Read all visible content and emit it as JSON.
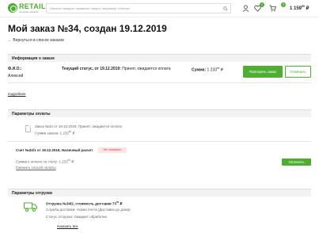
{
  "header": {
    "logo_text": "RETAIL",
    "logo_sub": "интернет-магазин",
    "search_placeholder": "Начните вводить название товара, например «Свечи»",
    "compare_count": "1",
    "cart_count": "3",
    "cart_price_main": "1 159",
    "cart_price_cents": "50",
    "cart_currency": "₽"
  },
  "page": {
    "title": "Мой заказ №34, создан 19.12.2019",
    "back_link": "← Вернуться в список заказов"
  },
  "order_info": {
    "heading": "Информация о заказе",
    "fio_label": "Ф.И.О.:",
    "fio_value": "Алексей",
    "status_label": "Текущий статус, от 19.12.2019:",
    "status_value": "Принят, ожидается оплата",
    "sum_label": "Сумма:",
    "sum_value": "1 233",
    "sum_cents": "50",
    "sum_currency": "₽",
    "repeat_button": "Повторить заказ",
    "cancel_button": "Отменить",
    "details_link": "подробнее"
  },
  "payment": {
    "heading": "Параметры оплаты",
    "line1": "Заказ №34 от 19.12.2019, Принят, ожидается оплата",
    "line2_label": "Сумма заказа:",
    "line2_value": "1 233",
    "line2_cents": "50",
    "line2_currency": "₽",
    "invoice_title": "Счет №34/1 от 19.12.2019, Наличный расчет",
    "invoice_status": "Не оплачено",
    "pay_sum_label": "Сумма к оплате по счету:",
    "pay_sum_value": "1 233",
    "pay_sum_cents": "50",
    "pay_sum_currency": "₽",
    "change_link": "Сменить способ оплаты",
    "pay_button": "Оплатить"
  },
  "shipment": {
    "heading": "Параметры отгрузки",
    "title": "Отгрузка №34/2, стоимость доставки 73",
    "title_cents": "50",
    "title_currency": "₽",
    "service": "Служба доставки: Новая почта (Доставка до дома)",
    "status": "Статус отгрузки: Ожидает обработки",
    "show_all_link": "показать все"
  }
}
